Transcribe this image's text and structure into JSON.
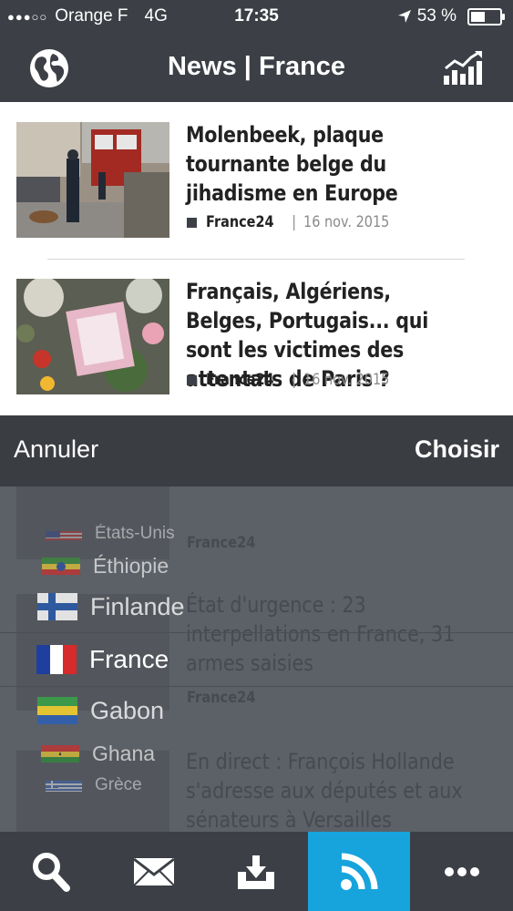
{
  "status_bar": {
    "signal_dots": "●●●○○",
    "carrier": "Orange F",
    "network": "4G",
    "time": "17:35",
    "battery": "53 %",
    "battery_level": 0.53
  },
  "header": {
    "title": "News | France",
    "left_icon": "globe-icon",
    "right_icon": "chart-icon"
  },
  "articles": [
    {
      "headline": "Molenbeek, plaque tournante belge du jihadisme en Europe",
      "source": "France24",
      "date": "16 nov. 2015"
    },
    {
      "headline": "Français, Algériens, Belges, Portugais... qui sont les victimes des attentats de Paris ?",
      "source": "France24",
      "date": "16 nov. 2015"
    }
  ],
  "picker": {
    "cancel_label": "Annuler",
    "choose_label": "Choisir",
    "countries": [
      {
        "name": "États-Unis",
        "flag": "us-flag"
      },
      {
        "name": "Éthiopie",
        "flag": "ethiopia-flag"
      },
      {
        "name": "Finlande",
        "flag": "finland-flag"
      },
      {
        "name": "France",
        "flag": "france-flag",
        "selected": true
      },
      {
        "name": "Gabon",
        "flag": "gabon-flag"
      },
      {
        "name": "Ghana",
        "flag": "ghana-flag"
      },
      {
        "name": "Grèce",
        "flag": "greece-flag"
      }
    ]
  },
  "background_articles": [
    {
      "source": "France24"
    },
    {
      "headline": "État d'urgence : 23 interpellations en France, 31 armes saisies",
      "source": "France24"
    },
    {
      "headline": "En direct : François Hollande s'adresse aux députés et aux sénateurs à Versailles"
    }
  ],
  "tab_bar": {
    "tabs": [
      {
        "icon": "search-icon"
      },
      {
        "icon": "mail-icon"
      },
      {
        "icon": "download-icon"
      },
      {
        "icon": "rss-icon",
        "active": true
      },
      {
        "icon": "more-icon"
      }
    ]
  }
}
